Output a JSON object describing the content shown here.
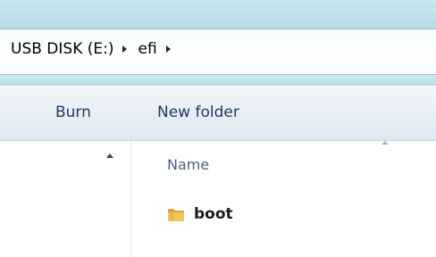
{
  "address": {
    "crumbs": [
      "USB DISK (E:)",
      "efi"
    ]
  },
  "toolbar": {
    "burn_label": "Burn",
    "new_folder_label": "New folder"
  },
  "file_list": {
    "column_name": "Name",
    "items": [
      {
        "name": "boot",
        "icon": "folder-icon"
      }
    ]
  },
  "colors": {
    "toolbar_text": "#1e395b",
    "folder": "#e6b84a"
  }
}
